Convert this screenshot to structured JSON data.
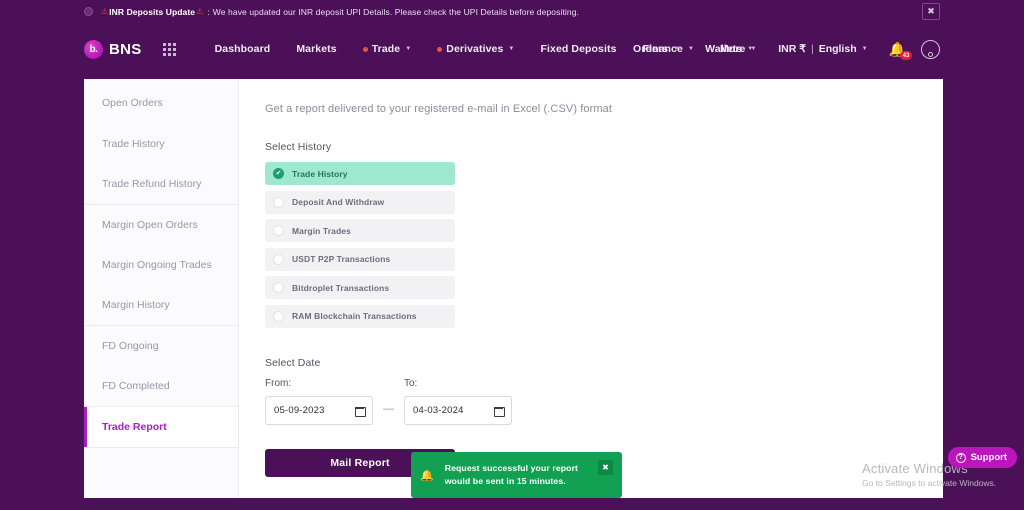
{
  "announcement": {
    "title": "INR Deposits Update",
    "separator": ":",
    "message": "We have updated our INR deposit UPI Details. Please check the UPI Details before depositing.",
    "warn_icon": "⚠",
    "close_icon": "✖"
  },
  "brand": {
    "mark": "b.",
    "name": "BNS"
  },
  "nav": {
    "apps_icon": "apps-grid-icon",
    "items": [
      {
        "label": "Dashboard",
        "dot": false,
        "caret": false
      },
      {
        "label": "Markets",
        "dot": false,
        "caret": false
      },
      {
        "label": "Trade",
        "dot": true,
        "caret": true
      },
      {
        "label": "Derivatives",
        "dot": true,
        "caret": true
      },
      {
        "label": "Fixed Deposits",
        "dot": false,
        "caret": false
      },
      {
        "label": "Finance",
        "dot": false,
        "caret": true
      },
      {
        "label": "More",
        "dot": false,
        "caret": true
      }
    ],
    "right_items": [
      {
        "label": "Orders",
        "caret": true
      },
      {
        "label": "Wallets",
        "caret": true
      }
    ],
    "currency": "INR ₹",
    "lang_separator": "|",
    "language": "English",
    "caret": "▼",
    "bell_icon": "🔔",
    "bell_badge": "43",
    "avatar": "user-avatar"
  },
  "sidebar": {
    "items": [
      {
        "label": "Open Orders",
        "active": false,
        "divider": false
      },
      {
        "label": "Trade History",
        "active": false,
        "divider": false
      },
      {
        "label": "Trade Refund History",
        "active": false,
        "divider": true
      },
      {
        "label": "Margin Open Orders",
        "active": false,
        "divider": false
      },
      {
        "label": "Margin Ongoing Trades",
        "active": false,
        "divider": false
      },
      {
        "label": "Margin History",
        "active": false,
        "divider": true
      },
      {
        "label": "FD Ongoing",
        "active": false,
        "divider": false
      },
      {
        "label": "FD Completed",
        "active": false,
        "divider": true
      },
      {
        "label": "Trade Report",
        "active": true,
        "divider": false
      }
    ]
  },
  "main": {
    "lead": "Get a report delivered to your registered e-mail in Excel (.CSV) format",
    "select_history_label": "Select History",
    "history_options": [
      {
        "label": "Trade History",
        "selected": true
      },
      {
        "label": "Deposit And Withdraw",
        "selected": false
      },
      {
        "label": "Margin Trades",
        "selected": false
      },
      {
        "label": "USDT P2P Transactions",
        "selected": false
      },
      {
        "label": "Bitdroplet Transactions",
        "selected": false
      },
      {
        "label": "RAM Blockchain Transactions",
        "selected": false
      }
    ],
    "check_icon": "✔",
    "select_date_label": "Select Date",
    "from_label": "From:",
    "to_label": "To:",
    "from_value": "05-09-2023",
    "to_value": "04-03-2024",
    "range_dash": "—",
    "calendar_icon": "calendar-icon",
    "mail_report_label": "Mail Report"
  },
  "toast": {
    "bell_icon": "🔔",
    "message": "Request successful your report would be sent in 15 minutes.",
    "close_icon": "✖"
  },
  "watermark": {
    "line1": "Activate Windows",
    "line2": "Go to Settings to activate Windows."
  },
  "support": {
    "icon": "?",
    "label": "Support"
  },
  "colors": {
    "brand_purple": "#4b1057",
    "accent_magenta": "#a720c4",
    "success_green": "#12a152",
    "selected_mint": "#9fe8cf",
    "alert_red": "#e8543f"
  }
}
